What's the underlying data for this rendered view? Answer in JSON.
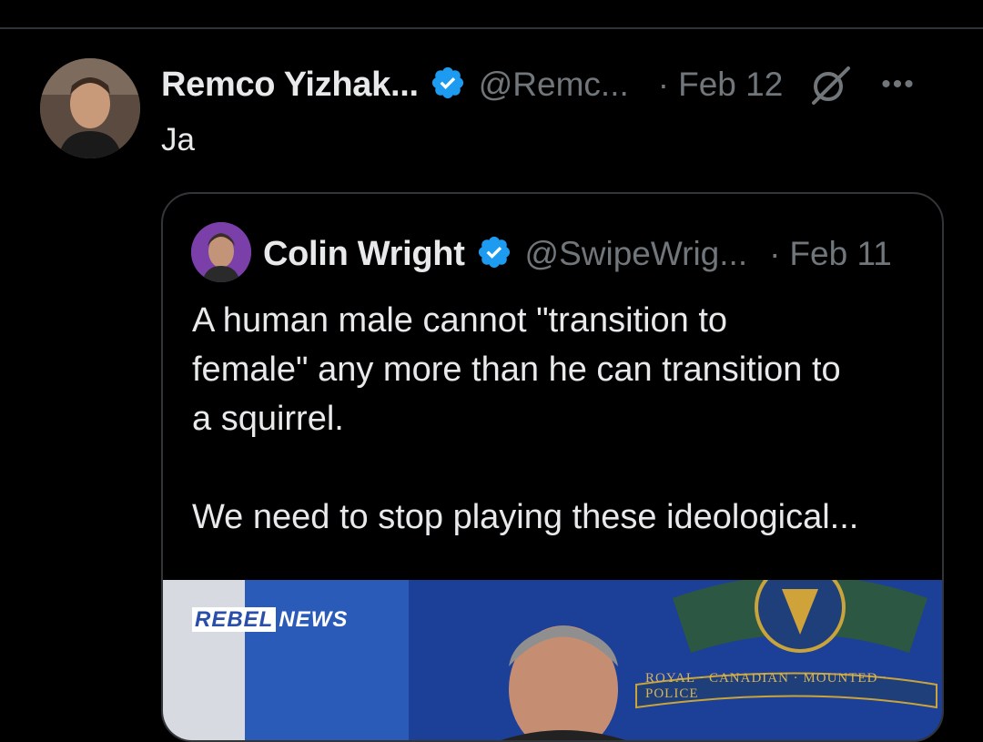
{
  "post": {
    "author_name": "Remco Yizhak...",
    "handle": "@Remc...",
    "date_separator": "·",
    "date": "Feb 12",
    "more_label": "•••",
    "text": "Ja"
  },
  "quote": {
    "author_name": "Colin Wright",
    "handle": "@SwipeWrig...",
    "date_separator": "·",
    "date": "Feb 11",
    "body": [
      "A human male cannot \"transition to",
      "female\" any more than he can transition to",
      "a squirrel.",
      "",
      "We need to stop playing these ideological..."
    ]
  },
  "media": {
    "logo_text_left": "REBEL",
    "logo_text_right": "NEWS",
    "crest_text": "ROYAL · CANADIAN · MOUNTED · POLICE"
  },
  "colors": {
    "background": "#000000",
    "text_primary": "#e7e9ea",
    "text_secondary": "#71767b",
    "verified_blue": "#1d9bf0",
    "divider": "#2f3336"
  },
  "icons": [
    "verified-badge-icon",
    "grok-icon",
    "more-options-icon"
  ]
}
